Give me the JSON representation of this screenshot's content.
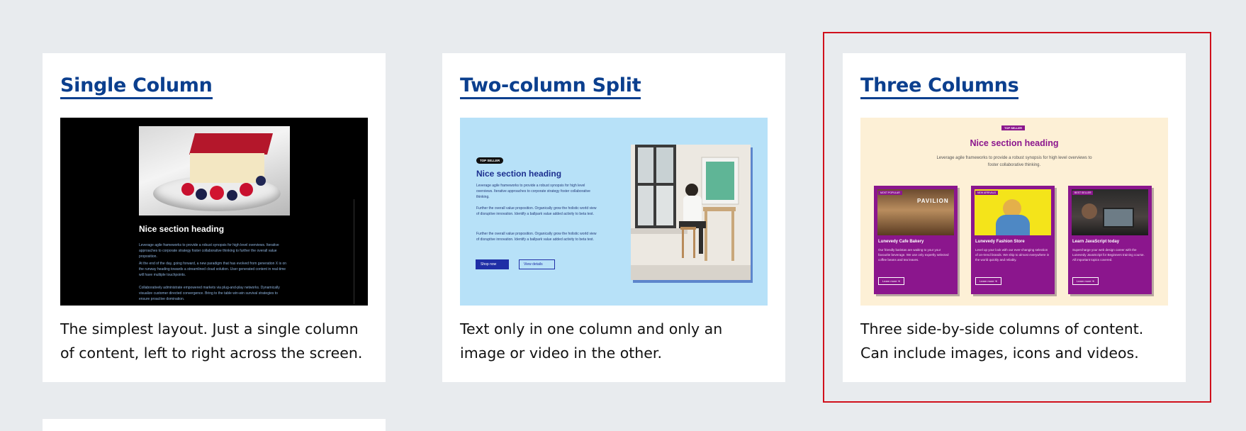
{
  "cards": [
    {
      "title": "Single Column",
      "description": "The simplest layout. Just a single column of content, left to right across the screen.",
      "preview": {
        "heading": "Nice section heading",
        "paragraphs": [
          "Leverage agile frameworks to provide a robust synopsis for high level overviews. Iterative approaches to corporate strategy foster collaborative thinking to further the overall value proposition.",
          "At the end of the day, going forward, a new paradigm that has evolved from generation X is on the runway heading towards a streamlined cloud solution. User generated content in real-time will have multiple touchpoints.",
          "Collaboratively administrate empowered markets via plug-and-play networks. Dynamically visualize customer directed convergence. Bring to the table win-win survival strategies to ensure proactive domination."
        ]
      }
    },
    {
      "title": "Two-column Split",
      "description": "Text only in one column and only an image or video in the other.",
      "preview": {
        "badge": "TOP SELLER",
        "heading": "Nice section heading",
        "paragraphs": [
          "Leverage agile frameworks to provide a robust synopsis for high level overviews. Iterative approaches to corporate strategy foster collaborative thinking.",
          "Further the overall value proposition. Organically grow the holistic world view of disruptive innovation. Identify a ballpark value added activity to beta test.",
          "Further the overall value proposition. Organically grow the holistic world view of disruptive innovation. Identify a ballpark value added activity to beta test."
        ],
        "primary_button": "Shop now",
        "secondary_button": "View details"
      }
    },
    {
      "title": "Three Columns",
      "description": "Three side-by-side columns of content. Can include images, icons and videos.",
      "preview": {
        "badge": "TOP SELLER",
        "heading": "Nice section heading",
        "subtitle": "Leverage agile frameworks to provide a robust synopsis for high level overviews to foster collaborative thinking.",
        "tiles": [
          {
            "tag": "MOST POPULAR",
            "title": "Lunevedy Cafe Bakery",
            "text": "Our friendly baristas are waiting to your your favourite beverage. We use only expertly selected coffee beans and tea leaves.",
            "button": "Learn more",
            "sign": "PAVILION"
          },
          {
            "tag": "NEW ARRIVALS",
            "title": "Lunevedy Fashion Store",
            "text": "Level up your look with our ever-changing selection of on-trend brands. We ship to almost everywhere in the world quickly and reliably.",
            "button": "Learn more"
          },
          {
            "tag": "BEST SELLER",
            "title": "Learn JavaScript today",
            "text": "Supercharge your web design career with the Lunevedy JavaScript for Beginners training course. All important topics covered.",
            "button": "Learn more"
          }
        ]
      }
    }
  ],
  "colors": {
    "page_background": "#e8ebee",
    "title_blue": "#0b3f8e",
    "highlight_red": "#d0101c",
    "tile_purple": "#8b168d"
  }
}
